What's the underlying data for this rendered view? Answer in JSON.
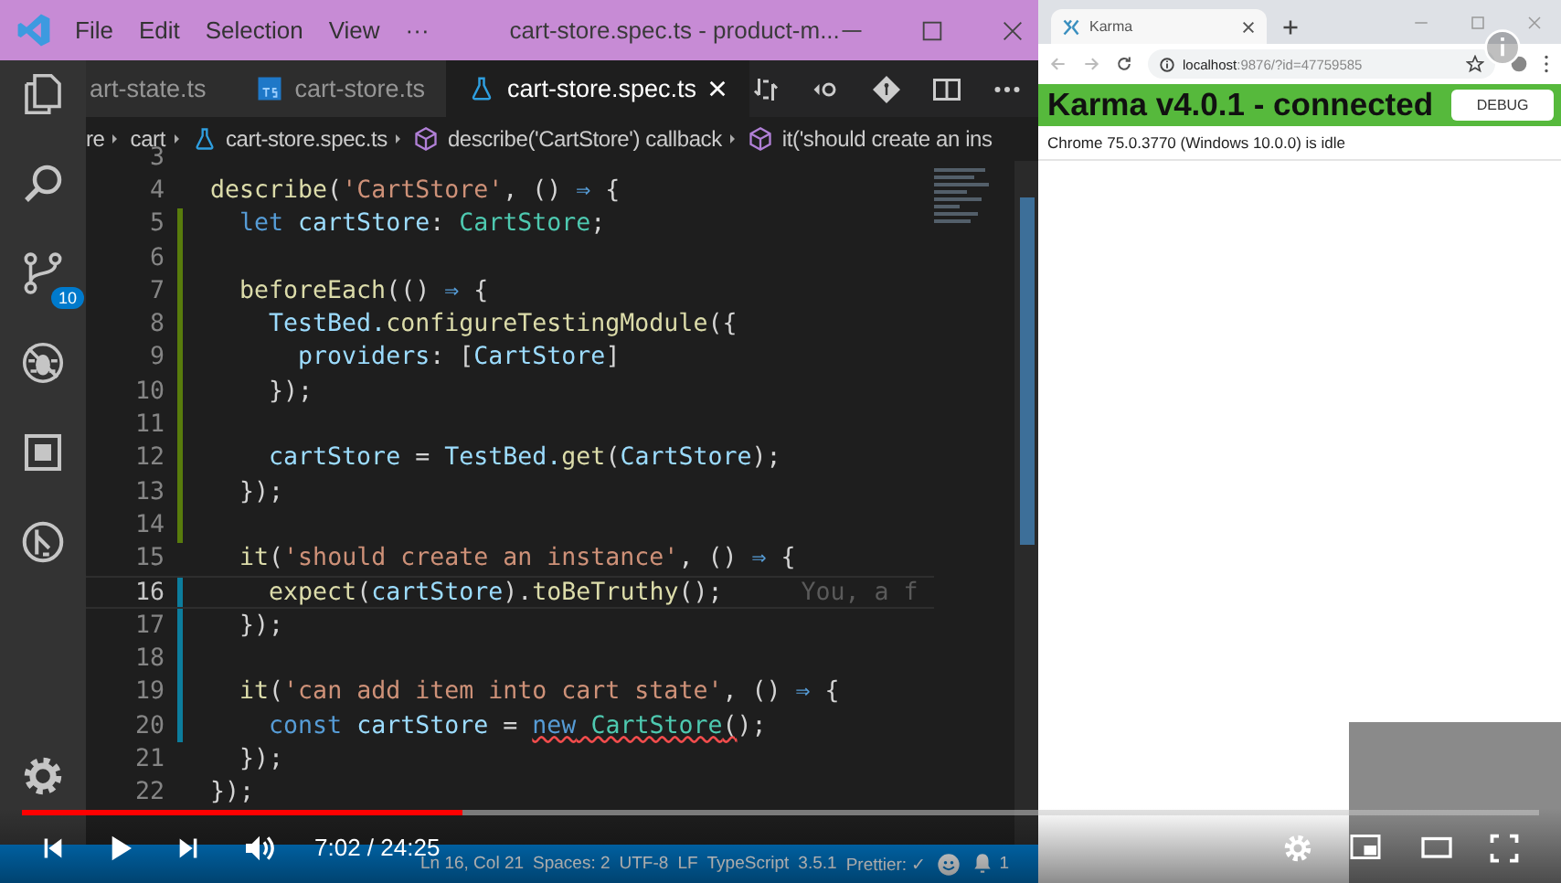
{
  "vscode": {
    "titlebar": {
      "menu": [
        "File",
        "Edit",
        "Selection",
        "View",
        "···"
      ],
      "title": "cart-store.spec.ts - product-m..."
    },
    "activity_bar": [
      {
        "kind": "files"
      },
      {
        "kind": "search"
      },
      {
        "kind": "source-control",
        "badge": "10"
      },
      {
        "kind": "debug"
      },
      {
        "kind": "extensions"
      },
      {
        "kind": "remote"
      },
      {
        "kind": "gear"
      }
    ],
    "tabs": [
      {
        "label": "art-state.ts",
        "kind": "plain",
        "selected": false
      },
      {
        "label": "cart-store.ts",
        "kind": "typescript",
        "selected": false
      },
      {
        "label": "cart-store.spec.ts",
        "kind": "test-file",
        "selected": true
      }
    ],
    "editor_actions": [
      {
        "kind": "compare"
      },
      {
        "kind": "back"
      },
      {
        "kind": "git"
      },
      {
        "kind": "split"
      },
      {
        "kind": "more"
      }
    ],
    "breadcrumbs": [
      {
        "label": "re",
        "kind": "plain"
      },
      {
        "label": "cart",
        "kind": "plain"
      },
      {
        "label": "cart-store.spec.ts",
        "kind": "test-file"
      },
      {
        "label": "describe('CartStore') callback",
        "kind": "symbol"
      },
      {
        "label": "it('should create an ins",
        "kind": "symbol"
      }
    ],
    "lines": [
      {
        "number": "3",
        "kind": "unchanged",
        "current": false
      },
      {
        "number": "4",
        "kind": "unchanged",
        "current": false,
        "tokens": [
          {
            "text": "describe",
            "kind": "func"
          },
          {
            "text": "(",
            "kind": "punct"
          },
          {
            "text": "'CartStore'",
            "kind": "string"
          },
          {
            "text": ", () ",
            "kind": "punct"
          },
          {
            "text": "⇒",
            "kind": "keyword"
          },
          {
            "text": " {",
            "kind": "punct"
          }
        ]
      },
      {
        "number": "5",
        "kind": "added",
        "current": false,
        "tokens": [
          {
            "text": "  let",
            "kind": "keyword"
          },
          {
            "text": " cartStore",
            "kind": "var"
          },
          {
            "text": ": ",
            "kind": "punct"
          },
          {
            "text": "CartStore",
            "kind": "type"
          },
          {
            "text": ";",
            "kind": "punct"
          }
        ]
      },
      {
        "number": "6",
        "kind": "added",
        "current": false
      },
      {
        "number": "7",
        "kind": "added",
        "current": false,
        "tokens": [
          {
            "text": "  beforeEach",
            "kind": "func"
          },
          {
            "text": "(() ",
            "kind": "punct"
          },
          {
            "text": "⇒",
            "kind": "keyword"
          },
          {
            "text": " {",
            "kind": "punct"
          }
        ]
      },
      {
        "number": "8",
        "kind": "added",
        "current": false,
        "tokens": [
          {
            "text": "    TestBed.",
            "kind": "var"
          },
          {
            "text": "configureTestingModule",
            "kind": "func"
          },
          {
            "text": "({",
            "kind": "punct"
          }
        ]
      },
      {
        "number": "9",
        "kind": "added",
        "current": false,
        "tokens": [
          {
            "text": "      providers",
            "kind": "var"
          },
          {
            "text": ": [",
            "kind": "punct"
          },
          {
            "text": "CartStore",
            "kind": "var"
          },
          {
            "text": "]",
            "kind": "punct"
          }
        ]
      },
      {
        "number": "10",
        "kind": "added",
        "current": false,
        "tokens": [
          {
            "text": "    });",
            "kind": "punct"
          }
        ]
      },
      {
        "number": "11",
        "kind": "added",
        "current": false
      },
      {
        "number": "12",
        "kind": "added",
        "current": false,
        "tokens": [
          {
            "text": "    cartStore",
            "kind": "var"
          },
          {
            "text": " = ",
            "kind": "punct"
          },
          {
            "text": "TestBed.",
            "kind": "var"
          },
          {
            "text": "get",
            "kind": "func"
          },
          {
            "text": "(",
            "kind": "punct"
          },
          {
            "text": "CartStore",
            "kind": "var"
          },
          {
            "text": ");",
            "kind": "punct"
          }
        ]
      },
      {
        "number": "13",
        "kind": "added",
        "current": false,
        "tokens": [
          {
            "text": "  });",
            "kind": "punct"
          }
        ]
      },
      {
        "number": "14",
        "kind": "added",
        "current": false
      },
      {
        "number": "15",
        "kind": "unchanged",
        "current": false,
        "tokens": [
          {
            "text": "  it",
            "kind": "func"
          },
          {
            "text": "(",
            "kind": "punct"
          },
          {
            "text": "'should create an instance'",
            "kind": "string"
          },
          {
            "text": ", () ",
            "kind": "punct"
          },
          {
            "text": "⇒",
            "kind": "keyword"
          },
          {
            "text": " {",
            "kind": "punct"
          }
        ]
      },
      {
        "number": "16",
        "kind": "modified",
        "current": true,
        "hint": "You, a f",
        "tokens": [
          {
            "text": "    expect",
            "kind": "func"
          },
          {
            "text": "(",
            "kind": "punct"
          },
          {
            "text": "cartStore",
            "kind": "var"
          },
          {
            "text": ").",
            "kind": "punct"
          },
          {
            "text": "toBeTruthy",
            "kind": "func"
          },
          {
            "text": "();",
            "kind": "punct"
          }
        ]
      },
      {
        "number": "17",
        "kind": "modified",
        "current": false,
        "tokens": [
          {
            "text": "  });",
            "kind": "punct"
          }
        ]
      },
      {
        "number": "18",
        "kind": "modified",
        "current": false
      },
      {
        "number": "19",
        "kind": "modified",
        "current": false,
        "tokens": [
          {
            "text": "  it",
            "kind": "func"
          },
          {
            "text": "(",
            "kind": "punct"
          },
          {
            "text": "'can add item into cart state'",
            "kind": "string"
          },
          {
            "text": ", () ",
            "kind": "punct"
          },
          {
            "text": "⇒",
            "kind": "keyword"
          },
          {
            "text": " {",
            "kind": "punct"
          }
        ]
      },
      {
        "number": "20",
        "kind": "modified",
        "current": false,
        "tokens": [
          {
            "text": "    const",
            "kind": "keyword",
            "error": false
          },
          {
            "text": " cartStore",
            "kind": "var",
            "error": false
          },
          {
            "text": " = ",
            "kind": "punct",
            "error": false
          },
          {
            "text": "new",
            "kind": "keyword",
            "error": true
          },
          {
            "text": " CartStore",
            "kind": "type",
            "error": true
          },
          {
            "text": "(",
            "kind": "punct",
            "error": true
          },
          {
            "text": ");",
            "kind": "punct",
            "error": false
          }
        ]
      },
      {
        "number": "21",
        "kind": "unchanged",
        "current": false,
        "tokens": [
          {
            "text": "  });",
            "kind": "punct"
          }
        ]
      },
      {
        "number": "22",
        "kind": "unchanged",
        "current": false,
        "tokens": [
          {
            "text": "});",
            "kind": "punct"
          }
        ]
      }
    ],
    "status_bar": [
      {
        "kind": "text",
        "text": "Ln 16, Col 21"
      },
      {
        "kind": "text",
        "text": "Spaces: 2"
      },
      {
        "kind": "text",
        "text": "UTF-8"
      },
      {
        "kind": "text",
        "text": "LF"
      },
      {
        "kind": "text",
        "text": "TypeScript"
      },
      {
        "kind": "text",
        "text": "3.5.1"
      },
      {
        "kind": "text",
        "text": "Prettier: ✓"
      },
      {
        "kind": "smiley"
      },
      {
        "kind": "bell",
        "text": "1"
      }
    ]
  },
  "browser": {
    "tab": {
      "title": "Karma"
    },
    "url": {
      "host": "localhost",
      "rest": ":9876/?id=47759585"
    },
    "karma": {
      "title": "Karma v4.0.1 - connected",
      "button": "DEBUG",
      "status": "Chrome 75.0.3770 (Windows 10.0.0) is idle"
    }
  },
  "player": {
    "level": 0.29,
    "time": "7:02 / 24:25"
  }
}
